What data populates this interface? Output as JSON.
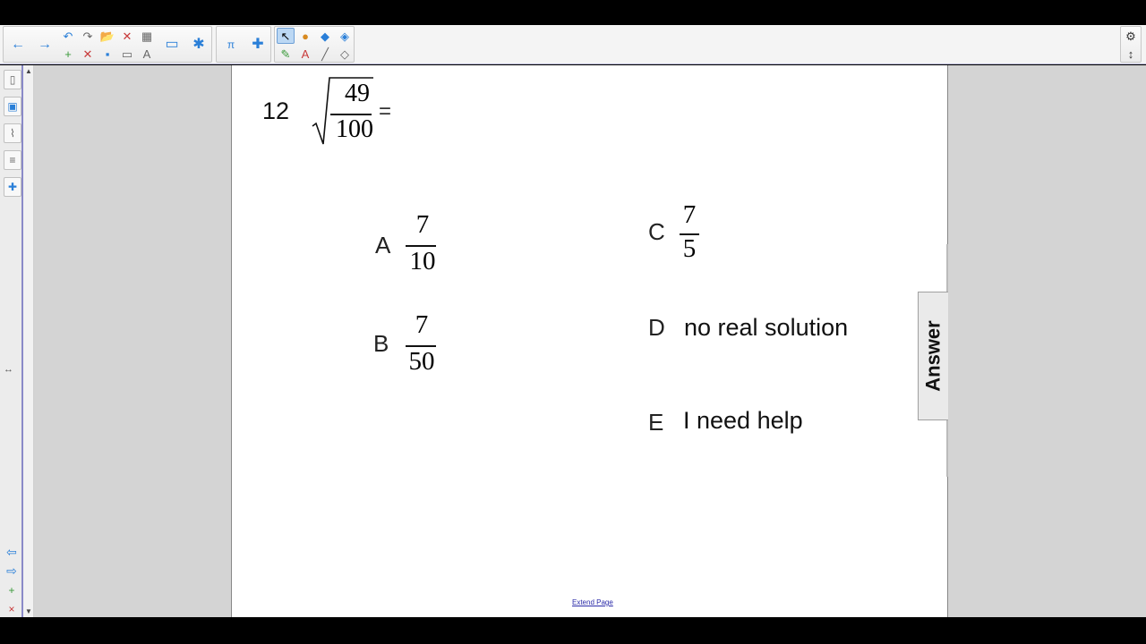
{
  "toolbar": {
    "groups": [
      "navigation",
      "edit",
      "tools",
      "settings"
    ],
    "icons": {
      "back": "←",
      "forward": "→",
      "undo": "↶",
      "redo": "↷",
      "open": "📂",
      "delete": "✕",
      "table": "▦",
      "screen": "▬",
      "add-page": "+",
      "remove-page": "✕",
      "save": "▪",
      "display": "▭",
      "accessibility": "A",
      "presentation": "▭",
      "addons": "✱",
      "math": "π",
      "puzzle": "✚",
      "select": "↖",
      "shapes": "●",
      "eraser": "◆",
      "fill": "◈",
      "pens": "✎",
      "text": "A",
      "line": "╱",
      "magic-eraser": "◇",
      "settings": "⚙",
      "move-toolbar": "↕"
    }
  },
  "sidebar": {
    "tabs": [
      "page-sorter",
      "gallery",
      "attachments",
      "properties",
      "addons"
    ],
    "resize": "↔",
    "nav": {
      "prev": "⇦",
      "next": "⇨",
      "add": "+",
      "remove": "×"
    },
    "icons": {
      "page-sorter": "▯",
      "gallery": "▣",
      "attachments": "⌇",
      "properties": "≡",
      "addons": "✚"
    }
  },
  "question": {
    "number": "12",
    "radicand": {
      "numerator": "49",
      "denominator": "100"
    },
    "equals": "="
  },
  "options": [
    {
      "letter": "A",
      "numerator": "7",
      "denominator": "10"
    },
    {
      "letter": "B",
      "numerator": "7",
      "denominator": "50"
    },
    {
      "letter": "C",
      "numerator": "7",
      "denominator": "5"
    },
    {
      "letter": "D",
      "text": "no real solution"
    },
    {
      "letter": "E",
      "text": "I need help"
    }
  ],
  "answer_tab": {
    "label": "Answer"
  },
  "footer": {
    "extend_page": "Extend Page"
  },
  "scroll": {
    "up": "▲",
    "down": "▼"
  },
  "colors": {
    "accent": "#2a7fd8",
    "page_border": "#8a8ac8",
    "workspace": "#d4d4d4"
  }
}
